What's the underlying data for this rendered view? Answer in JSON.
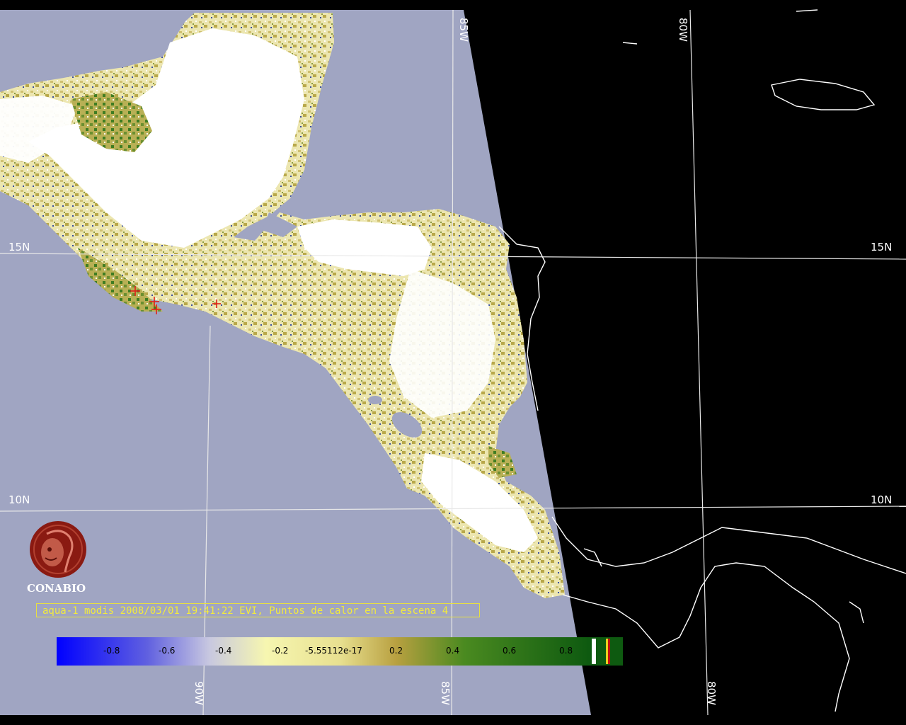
{
  "map": {
    "title": "aqua-1 modis 2008/03/01 19:41:22 EVI, Puntos de calor en la escena 4",
    "grid_labels": {
      "lat_15n_left": "15N",
      "lat_15n_right": "15N",
      "lat_10n_left": "10N",
      "lat_10n_right": "10N",
      "lon_85w_top": "85W",
      "lon_80w_top": "80W",
      "lon_90w_bottom": "90W",
      "lon_85w_bottom": "85W",
      "lon_80w_bottom": "80W"
    },
    "colorbar": {
      "labels": [
        "-0.8",
        "-0.6",
        "-0.4",
        "-0.2",
        "-5.55112e-17",
        "0.2",
        "0.4",
        "0.6",
        "0.8"
      ]
    },
    "logo": {
      "text": "CONABIO"
    },
    "hotspots_count": 4,
    "colors": {
      "ocean": "#a0a5c2",
      "no_data": "#000000",
      "cloud": "#ffffff",
      "veg_low": "#e0d890",
      "veg_high": "#2e7a1a",
      "hotspot": "#e0201a",
      "caption": "#f2ea3c"
    }
  }
}
